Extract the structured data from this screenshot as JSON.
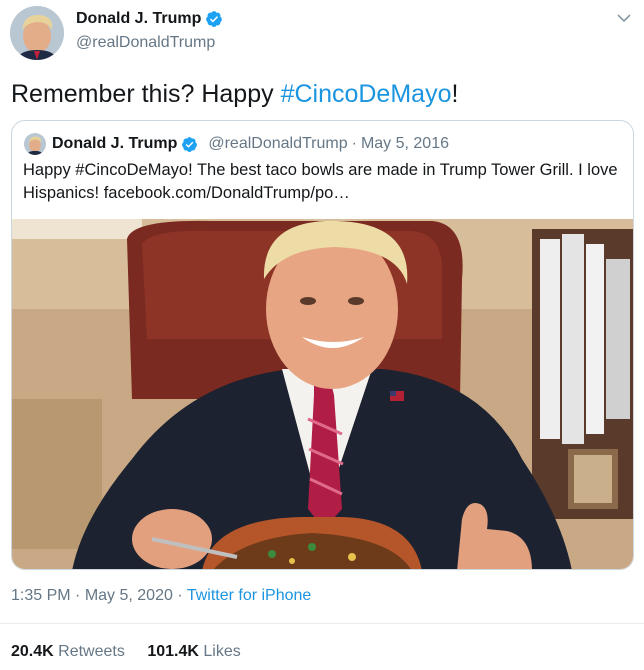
{
  "author": {
    "name": "Donald J. Trump",
    "handle": "@realDonaldTrump"
  },
  "tweet": {
    "text_prefix": "Remember this? Happy ",
    "hashtag": "#CincoDeMayo",
    "text_suffix": "!"
  },
  "quoted": {
    "name": "Donald J. Trump",
    "handle": "@realDonaldTrump",
    "separator": "·",
    "date": "May 5, 2016",
    "text": "Happy #CincoDeMayo! The best taco bowls are made in Trump Tower Grill. I love Hispanics! ",
    "link": "facebook.com/DonaldTrump/po…"
  },
  "meta": {
    "time": "1:35 PM",
    "sep1": " · ",
    "date": "May 5, 2020",
    "sep2": " · ",
    "source": "Twitter for iPhone"
  },
  "stats": {
    "retweets_count": "20.4K",
    "retweets_label": "Retweets",
    "likes_count": "101.4K",
    "likes_label": "Likes"
  },
  "colors": {
    "accent": "#1b95e0",
    "verified": "#1da1f2",
    "secondary_text": "#657786"
  },
  "icons": {
    "verified": "verified-badge-icon",
    "menu": "chevron-down-icon"
  }
}
